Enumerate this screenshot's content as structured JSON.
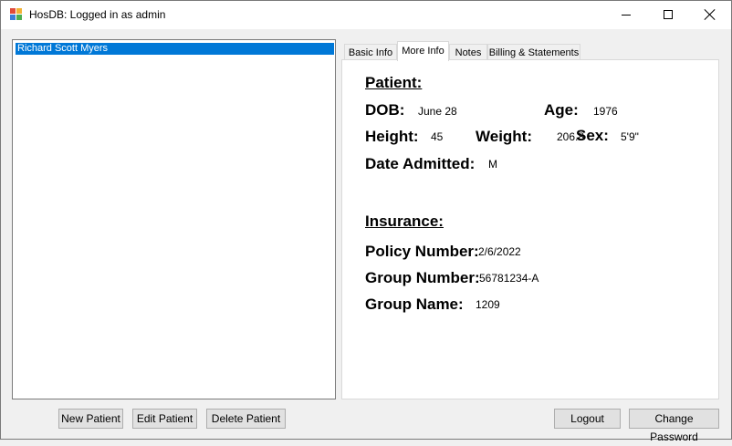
{
  "window": {
    "title": "HosDB: Logged in as admin",
    "icon": "app-icon",
    "controls": {
      "minimize": "minimize-icon",
      "maximize": "maximize-icon",
      "close": "close-icon"
    }
  },
  "patients": {
    "items": [
      "Richard Scott Myers"
    ],
    "selected_index": 0
  },
  "tabs": [
    {
      "label": "Basic Info",
      "active": false
    },
    {
      "label": "More Info",
      "active": true
    },
    {
      "label": "Notes",
      "active": false
    },
    {
      "label": "Billing & Statements",
      "active": false
    }
  ],
  "more_info": {
    "patient_heading": "Patient: ",
    "dob_label": "DOB:",
    "dob_value": "June 28",
    "age_label": "Age:",
    "age_value": "1976",
    "height_label": "Height:",
    "height_value": "45",
    "weight_label": "Weight:",
    "weight_value": "206.8",
    "sex_label": "Sex:",
    "sex_value": "5'9\"",
    "admitted_label": "Date Admitted:",
    "admitted_value": "M",
    "insurance_heading": "Insurance:",
    "policy_label": "Policy Number:",
    "policy_value": "2/6/2022",
    "group_number_label": "Group Number:",
    "group_number_value": "56781234-A",
    "group_name_label": "Group Name:",
    "group_name_value": "1209"
  },
  "buttons": {
    "new_patient": "New Patient",
    "edit_patient": "Edit Patient",
    "delete_patient": "Delete Patient",
    "logout": "Logout",
    "change_password": "Change Password"
  },
  "colors": {
    "selection": "#0078d7",
    "window_bg": "#f0f0f0",
    "button_bg": "#e1e1e1"
  }
}
